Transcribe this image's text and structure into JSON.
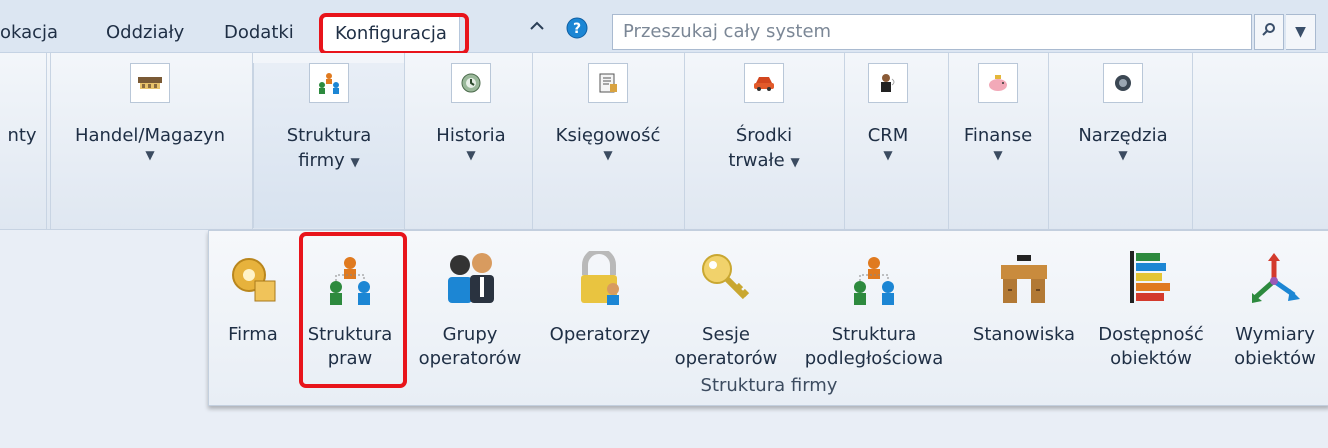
{
  "tabs": [
    "okacja",
    "Oddziały",
    "Dodatki",
    "Konfiguracja"
  ],
  "search": {
    "placeholder": "Przeszukaj cały system"
  },
  "toolbar": {
    "collapse_icon": "chevron-up",
    "help_icon": "help"
  },
  "ribbon": [
    {
      "label": "nty"
    },
    {
      "label": "Handel/Magazyn",
      "icon": "warehouse"
    },
    {
      "label1": "Struktura",
      "label2": "firmy",
      "icon": "org-structure"
    },
    {
      "label": "Historia",
      "icon": "history"
    },
    {
      "label": "Księgowość",
      "icon": "accounting"
    },
    {
      "label1": "Środki",
      "label2": "trwałe",
      "icon": "car"
    },
    {
      "label": "CRM",
      "icon": "crm"
    },
    {
      "label": "Finanse",
      "icon": "piggy-bank"
    },
    {
      "label": "Narzędzia",
      "icon": "tools"
    }
  ],
  "dropdown": {
    "group_label": "Struktura firmy",
    "items": [
      {
        "l1": "Firma",
        "l2": "",
        "icon": "gear"
      },
      {
        "l1": "Struktura",
        "l2": "praw",
        "icon": "permission-structure"
      },
      {
        "l1": "Grupy",
        "l2": "operatorów",
        "icon": "user-group"
      },
      {
        "l1": "Operatorzy",
        "l2": "",
        "icon": "lock-user"
      },
      {
        "l1": "Sesje",
        "l2": "operatorów",
        "icon": "key"
      },
      {
        "l1": "Struktura",
        "l2": "podległościowa",
        "icon": "hierarchy"
      },
      {
        "l1": "Stanowiska",
        "l2": "",
        "icon": "desk"
      },
      {
        "l1": "Dostępność",
        "l2": "obiektów",
        "icon": "availability"
      },
      {
        "l1": "Wymiary",
        "l2": "obiektów",
        "icon": "dimensions"
      }
    ]
  },
  "colors": {
    "highlight": "#e8141b",
    "accent": "#1c86d4"
  }
}
